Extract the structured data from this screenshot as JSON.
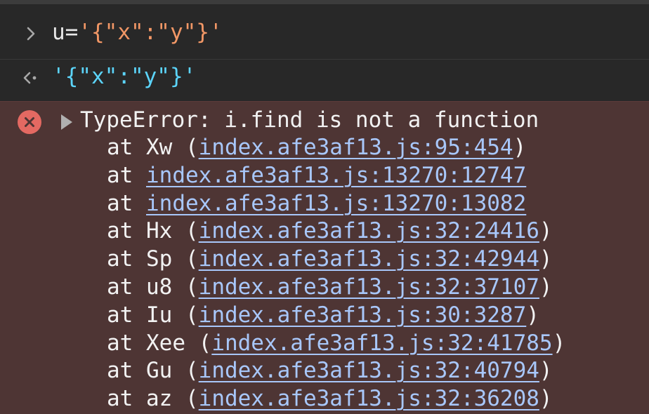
{
  "input": {
    "prefix": "u=",
    "value": "'{\"x\":\"y\"}'",
    "prompt_icon": "chevron-right-icon"
  },
  "result": {
    "value": "'{\"x\":\"y\"}'",
    "return_icon": "return-arrow-icon"
  },
  "error": {
    "icon": "error-x-icon",
    "toggle_icon": "disclosure-triangle-icon",
    "message": "TypeError: i.find is not a function",
    "frames": [
      {
        "prefix": "at Xw (",
        "link": "index.afe3af13.js:95:454",
        "suffix": ")"
      },
      {
        "prefix": "at ",
        "link": "index.afe3af13.js:13270:12747",
        "suffix": ""
      },
      {
        "prefix": "at ",
        "link": "index.afe3af13.js:13270:13082",
        "suffix": ""
      },
      {
        "prefix": "at Hx (",
        "link": "index.afe3af13.js:32:24416",
        "suffix": ")"
      },
      {
        "prefix": "at Sp (",
        "link": "index.afe3af13.js:32:42944",
        "suffix": ")"
      },
      {
        "prefix": "at u8 (",
        "link": "index.afe3af13.js:32:37107",
        "suffix": ")"
      },
      {
        "prefix": "at Iu (",
        "link": "index.afe3af13.js:30:3287",
        "suffix": ")"
      },
      {
        "prefix": "at Xee (",
        "link": "index.afe3af13.js:32:41785",
        "suffix": ")"
      },
      {
        "prefix": "at Gu (",
        "link": "index.afe3af13.js:32:40794",
        "suffix": ")"
      },
      {
        "prefix": "at az (",
        "link": "index.afe3af13.js:32:36208",
        "suffix": ")"
      }
    ]
  },
  "colors": {
    "background": "#282828",
    "string": "#f29766",
    "result": "#5cd5fb",
    "error_background": "#4e3534",
    "error_icon": "#e46962",
    "link": "#a8c7fa"
  }
}
